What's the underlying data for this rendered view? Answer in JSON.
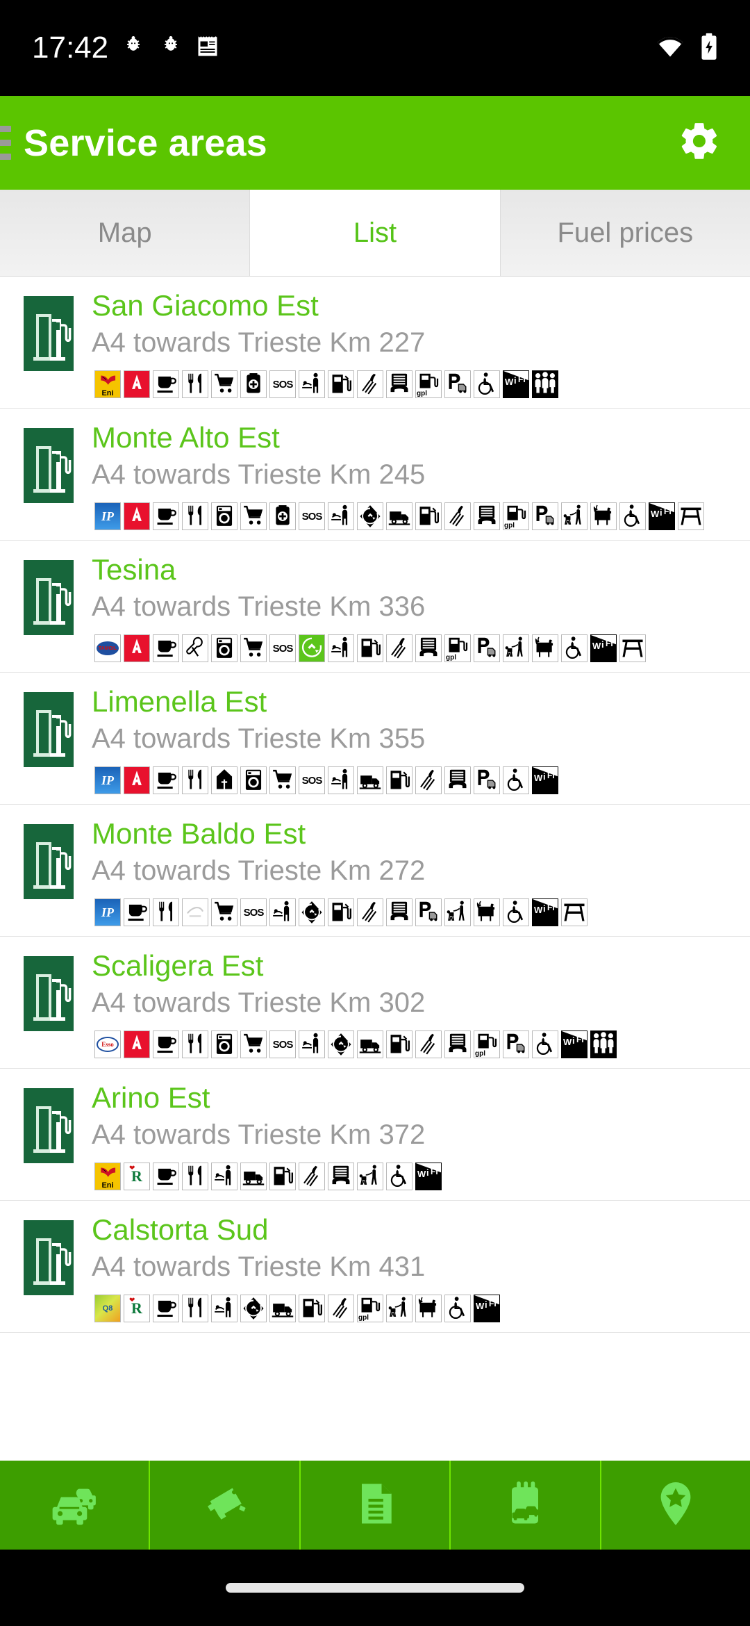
{
  "statusbar": {
    "time": "17:42",
    "left_icons": [
      "debug-bug-icon",
      "debug-bug-icon",
      "notes-icon"
    ],
    "right_icons": [
      "wifi-icon",
      "battery-charging-icon"
    ]
  },
  "appbar": {
    "menu_icon": "hamburger-menu-icon",
    "title": "Service areas",
    "settings_icon": "gear-icon",
    "background_color": "#5BC500"
  },
  "tabs": [
    {
      "label": "Map",
      "active": false
    },
    {
      "label": "List",
      "active": true
    },
    {
      "label": "Fuel prices",
      "active": false
    }
  ],
  "colors": {
    "accent_green": "#5BC500",
    "title_green": "#5BC51B",
    "subtitle_gray": "#9b9b9b",
    "badge_green": "#17663B",
    "bottom_nav_green": "#3D9E00",
    "bottom_nav_icon_green": "#6FE45A"
  },
  "list": {
    "items": [
      {
        "name": "San Giacomo Est",
        "location": "A4 towards Trieste Km 227",
        "badge_icon": "fuel-station-icon",
        "amenities": [
          "eni-logo",
          "autogrill-logo",
          "coffee-icon",
          "restaurant-icon",
          "shopping-cart-icon",
          "first-aid-icon",
          "sos-icon",
          "baby-changing-icon",
          "fuel-pump-icon",
          "car-wash-icon",
          "phone-icon",
          "gpl-icon",
          "parking-icon",
          "wheelchair-icon",
          "wifi-icon",
          "family-icon"
        ]
      },
      {
        "name": "Monte Alto Est",
        "location": "A4 towards Trieste Km 245",
        "badge_icon": "fuel-station-icon",
        "amenities": [
          "ip-logo",
          "autogrill-logo",
          "coffee-icon",
          "restaurant-icon",
          "laundry-icon",
          "shopping-cart-icon",
          "first-aid-icon",
          "sos-icon",
          "baby-changing-icon",
          "recycle-icon",
          "truck-icon",
          "fuel-pump-icon",
          "car-wash-icon",
          "phone-icon",
          "gpl-icon",
          "parking-icon",
          "dog-walk-icon",
          "dog-icon",
          "wheelchair-icon",
          "wifi-icon",
          "picnic-icon"
        ]
      },
      {
        "name": "Tesina",
        "location": "A4 towards Trieste Km 336",
        "badge_icon": "fuel-station-icon",
        "amenities": [
          "tamoil-logo",
          "autogrill-logo",
          "coffee-icon",
          "mechanic-icon",
          "laundry-icon",
          "shopping-cart-icon",
          "sos-icon",
          "recycle-green-icon",
          "baby-changing-icon",
          "fuel-pump-icon",
          "car-wash-icon",
          "phone-icon",
          "gpl-icon",
          "parking-icon",
          "dog-walk-icon",
          "dog-icon",
          "wheelchair-icon",
          "wifi-icon",
          "picnic-icon"
        ]
      },
      {
        "name": "Limenella Est",
        "location": "A4 towards Trieste Km 355",
        "badge_icon": "fuel-station-icon",
        "amenities": [
          "ip-logo",
          "autogrill-logo",
          "coffee-icon",
          "restaurant-icon",
          "chapel-icon",
          "laundry-icon",
          "shopping-cart-icon",
          "sos-icon",
          "baby-changing-icon",
          "truck-icon",
          "fuel-pump-icon",
          "car-wash-icon",
          "phone-icon",
          "parking-icon",
          "wheelchair-icon",
          "wifi-icon"
        ]
      },
      {
        "name": "Monte Baldo Est",
        "location": "A4 towards Trieste Km 272",
        "badge_icon": "fuel-station-icon",
        "amenities": [
          "ip-logo",
          "coffee-icon",
          "restaurant-icon",
          "faded-logo",
          "shopping-cart-icon",
          "sos-icon",
          "baby-changing-icon",
          "recycle-icon",
          "fuel-pump-icon",
          "car-wash-icon",
          "phone-icon",
          "parking-icon",
          "dog-walk-icon",
          "dog-icon",
          "wheelchair-icon",
          "wifi-icon",
          "picnic-icon"
        ]
      },
      {
        "name": "Scaligera Est",
        "location": "A4 towards Trieste Km 302",
        "badge_icon": "fuel-station-icon",
        "amenities": [
          "esso-logo",
          "autogrill-logo",
          "coffee-icon",
          "restaurant-icon",
          "laundry-icon",
          "shopping-cart-icon",
          "sos-icon",
          "baby-changing-icon",
          "recycle-icon",
          "truck-icon",
          "fuel-pump-icon",
          "car-wash-icon",
          "phone-icon",
          "gpl-icon",
          "parking-icon",
          "wheelchair-icon",
          "wifi-icon",
          "family-icon"
        ]
      },
      {
        "name": "Arino Est",
        "location": "A4 towards Trieste Km 372",
        "badge_icon": "fuel-station-icon",
        "amenities": [
          "eni-logo",
          "roadhouse-logo",
          "coffee-icon",
          "restaurant-icon",
          "baby-changing-icon",
          "truck-icon",
          "fuel-pump-icon",
          "car-wash-icon",
          "phone-icon",
          "dog-walk-icon",
          "wheelchair-icon",
          "wifi-icon"
        ]
      },
      {
        "name": "Calstorta Sud",
        "location": "A4 towards Trieste Km 431",
        "badge_icon": "fuel-station-icon",
        "amenities": [
          "q8-logo",
          "roadhouse-logo",
          "coffee-icon",
          "restaurant-icon",
          "baby-changing-icon",
          "recycle-icon",
          "truck-icon",
          "fuel-pump-icon",
          "car-wash-icon",
          "gpl-icon",
          "dog-walk-icon",
          "dog-icon",
          "wheelchair-icon",
          "wifi-icon"
        ]
      }
    ]
  },
  "bottom_nav": {
    "items": [
      {
        "icon": "traffic-icon"
      },
      {
        "icon": "speed-camera-icon"
      },
      {
        "icon": "document-icon"
      },
      {
        "icon": "vehicle-calendar-icon"
      },
      {
        "icon": "map-pin-star-icon"
      }
    ]
  },
  "navbar": {
    "home_indicator": "home-pill"
  }
}
